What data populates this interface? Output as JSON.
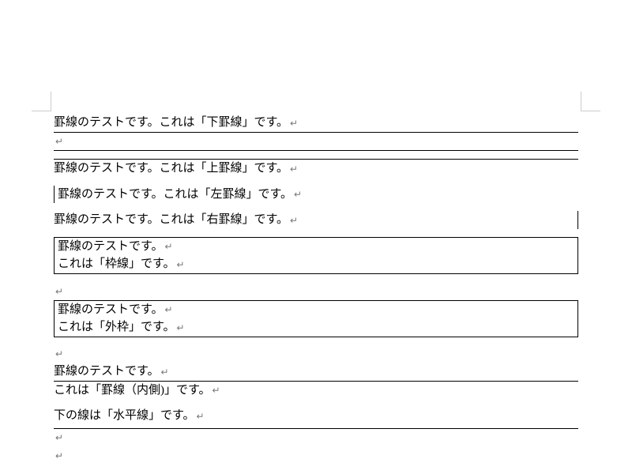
{
  "lines": {
    "bottom": "罫線のテストです。これは「下罫線」です。",
    "top": "罫線のテストです。これは「上罫線」です。",
    "left": "罫線のテストです。これは「左罫線」です。",
    "right": "罫線のテストです。これは「右罫線」です。",
    "box1": "罫線のテストです。",
    "box2": "これは「枠線」です。",
    "outer1": "罫線のテストです。",
    "outer2": "これは「外枠」です。",
    "inner1": "罫線のテストです。",
    "inner2": "これは「罫線（内側)」です。",
    "horiz": "下の線は「水平線」です。"
  }
}
